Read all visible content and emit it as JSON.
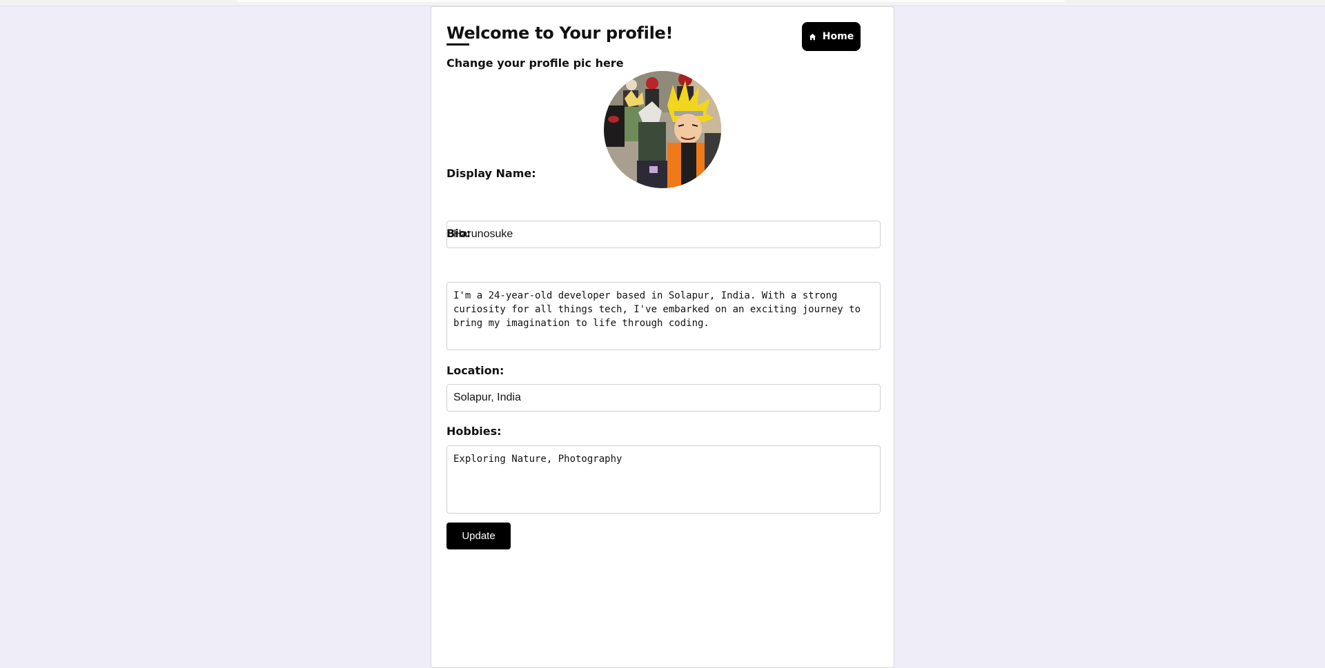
{
  "header": {
    "title": "Welcome to Your profile!",
    "home_label": "Home",
    "home_icon": "home-icon"
  },
  "profile_pic": {
    "heading": "Change your profile pic here",
    "image": "anime-characters-avatar"
  },
  "form": {
    "display_name": {
      "label": "Display Name:",
      "value": "Harunosuke"
    },
    "bio": {
      "label": "Bio:",
      "value": "I'm a 24-year-old developer based in Solapur, India. With a strong curiosity for all things tech, I've embarked on an exciting journey to bring my imagination to life through coding."
    },
    "location": {
      "label": "Location:",
      "value": "Solapur, India"
    },
    "hobbies": {
      "label": "Hobbies:",
      "value": "Exploring Nature, Photography"
    },
    "update_label": "Update"
  },
  "colors": {
    "page_background": "#efedf8",
    "card_background": "#ffffff",
    "button_background": "#000000",
    "button_text": "#ffffff"
  }
}
